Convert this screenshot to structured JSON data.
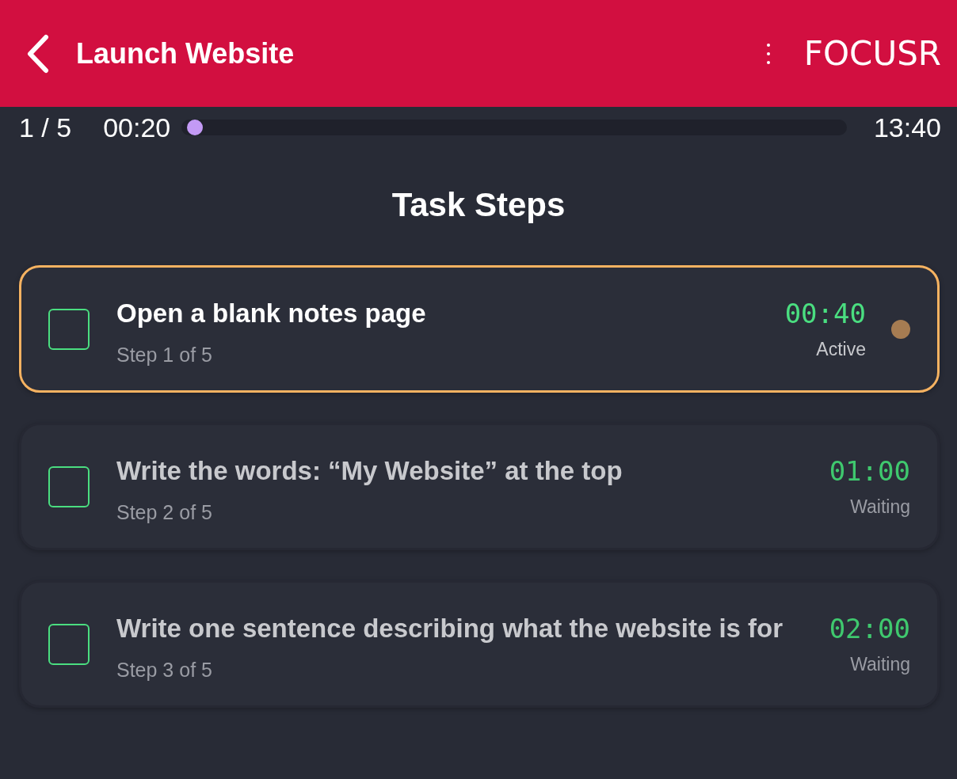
{
  "header": {
    "title": "Launch Website",
    "brand": "FOCUSR"
  },
  "progress": {
    "count": "1 / 5",
    "elapsed": "00:20",
    "remaining": "13:40",
    "level": 0.02
  },
  "section_title": "Task Steps",
  "steps": [
    {
      "title": "Open a blank notes page",
      "subtitle": "Step 1 of 5",
      "time": "00:40",
      "status": "Active",
      "selected": true,
      "checked": false
    },
    {
      "title": "Write the words: “My Website” at the top",
      "subtitle": "Step 2 of 5",
      "time": "01:00",
      "status": "Waiting",
      "selected": false,
      "checked": false
    },
    {
      "title": "Write one sentence describing what the website is for",
      "subtitle": "Step 3 of 5",
      "time": "02:00",
      "status": "Waiting",
      "selected": false,
      "checked": false
    }
  ]
}
